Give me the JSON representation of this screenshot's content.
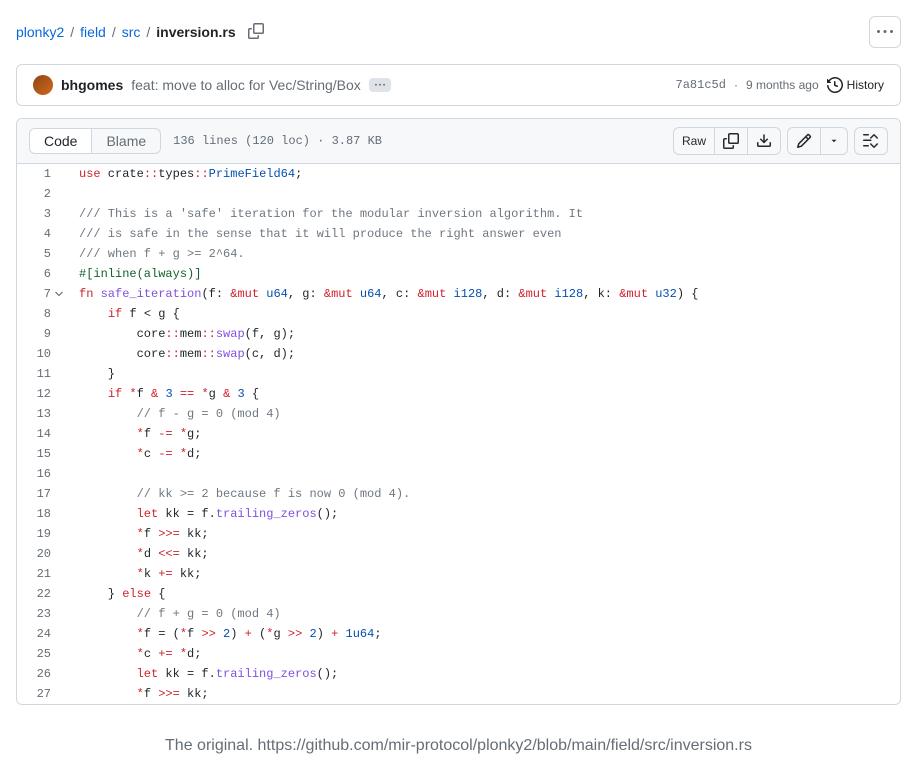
{
  "breadcrumb": {
    "parts": [
      "plonky2",
      "field",
      "src"
    ],
    "current": "inversion.rs"
  },
  "commit": {
    "author": "bhgomes",
    "message": "feat: move to alloc for Vec/String/Box",
    "sha": "7a81c5d",
    "age": "9 months ago",
    "history_label": "History"
  },
  "toolbar": {
    "code_tab": "Code",
    "blame_tab": "Blame",
    "file_info": "136 lines (120 loc) · 3.87 KB",
    "raw_label": "Raw"
  },
  "code_lines": [
    {
      "n": 1,
      "html": "<span class='c-kw'>use</span> crate<span class='c-op'>::</span>types<span class='c-op'>::</span><span class='c-type'>PrimeField64</span>;"
    },
    {
      "n": 2,
      "html": ""
    },
    {
      "n": 3,
      "html": "<span class='c-cmt'>/// This is a 'safe' iteration for the modular inversion algorithm. It</span>"
    },
    {
      "n": 4,
      "html": "<span class='c-cmt'>/// is safe in the sense that it will produce the right answer even</span>"
    },
    {
      "n": 5,
      "html": "<span class='c-cmt'>/// when f + g >= 2^64.</span>"
    },
    {
      "n": 6,
      "html": "<span class='c-attr'>#[inline(always)]</span>"
    },
    {
      "n": 7,
      "chev": true,
      "html": "<span class='c-kw'>fn</span> <span class='c-fn'>safe_iteration</span>(f: <span class='c-op'>&amp;mut</span> <span class='c-type'>u64</span>, g: <span class='c-op'>&amp;mut</span> <span class='c-type'>u64</span>, c: <span class='c-op'>&amp;mut</span> <span class='c-type'>i128</span>, d: <span class='c-op'>&amp;mut</span> <span class='c-type'>i128</span>, k: <span class='c-op'>&amp;mut</span> <span class='c-type'>u32</span>) {"
    },
    {
      "n": 8,
      "html": "    <span class='c-kw'>if</span> f &lt; g {"
    },
    {
      "n": 9,
      "html": "        core<span class='c-op'>::</span>mem<span class='c-op'>::</span><span class='c-fn'>swap</span>(f, g);"
    },
    {
      "n": 10,
      "html": "        core<span class='c-op'>::</span>mem<span class='c-op'>::</span><span class='c-fn'>swap</span>(c, d);"
    },
    {
      "n": 11,
      "html": "    }"
    },
    {
      "n": 12,
      "html": "    <span class='c-kw'>if</span> <span class='c-op'>*</span>f <span class='c-op'>&amp;</span> <span class='c-num'>3</span> <span class='c-op'>==</span> <span class='c-op'>*</span>g <span class='c-op'>&amp;</span> <span class='c-num'>3</span> {"
    },
    {
      "n": 13,
      "html": "        <span class='c-cmt'>// f - g = 0 (mod 4)</span>"
    },
    {
      "n": 14,
      "html": "        <span class='c-op'>*</span>f <span class='c-op'>-=</span> <span class='c-op'>*</span>g;"
    },
    {
      "n": 15,
      "html": "        <span class='c-op'>*</span>c <span class='c-op'>-=</span> <span class='c-op'>*</span>d;"
    },
    {
      "n": 16,
      "html": ""
    },
    {
      "n": 17,
      "html": "        <span class='c-cmt'>// kk >= 2 because f is now 0 (mod 4).</span>"
    },
    {
      "n": 18,
      "html": "        <span class='c-kw'>let</span> kk = f.<span class='c-fn'>trailing_zeros</span>();"
    },
    {
      "n": 19,
      "html": "        <span class='c-op'>*</span>f <span class='c-op'>&gt;&gt;=</span> kk;"
    },
    {
      "n": 20,
      "html": "        <span class='c-op'>*</span>d <span class='c-op'>&lt;&lt;=</span> kk;"
    },
    {
      "n": 21,
      "html": "        <span class='c-op'>*</span>k <span class='c-op'>+=</span> kk;"
    },
    {
      "n": 22,
      "html": "    } <span class='c-kw'>else</span> {"
    },
    {
      "n": 23,
      "html": "        <span class='c-cmt'>// f + g = 0 (mod 4)</span>"
    },
    {
      "n": 24,
      "html": "        <span class='c-op'>*</span>f = (<span class='c-op'>*</span>f <span class='c-op'>&gt;&gt;</span> <span class='c-num'>2</span>) <span class='c-op'>+</span> (<span class='c-op'>*</span>g <span class='c-op'>&gt;&gt;</span> <span class='c-num'>2</span>) <span class='c-op'>+</span> <span class='c-num'>1u64</span>;"
    },
    {
      "n": 25,
      "html": "        <span class='c-op'>*</span>c <span class='c-op'>+=</span> <span class='c-op'>*</span>d;"
    },
    {
      "n": 26,
      "html": "        <span class='c-kw'>let</span> kk = f.<span class='c-fn'>trailing_zeros</span>();"
    },
    {
      "n": 27,
      "html": "        <span class='c-op'>*</span>f <span class='c-op'>&gt;&gt;=</span> kk;"
    }
  ],
  "caption": "The original. https://github.com/mir-protocol/plonky2/blob/main/field/src/inversion.rs"
}
